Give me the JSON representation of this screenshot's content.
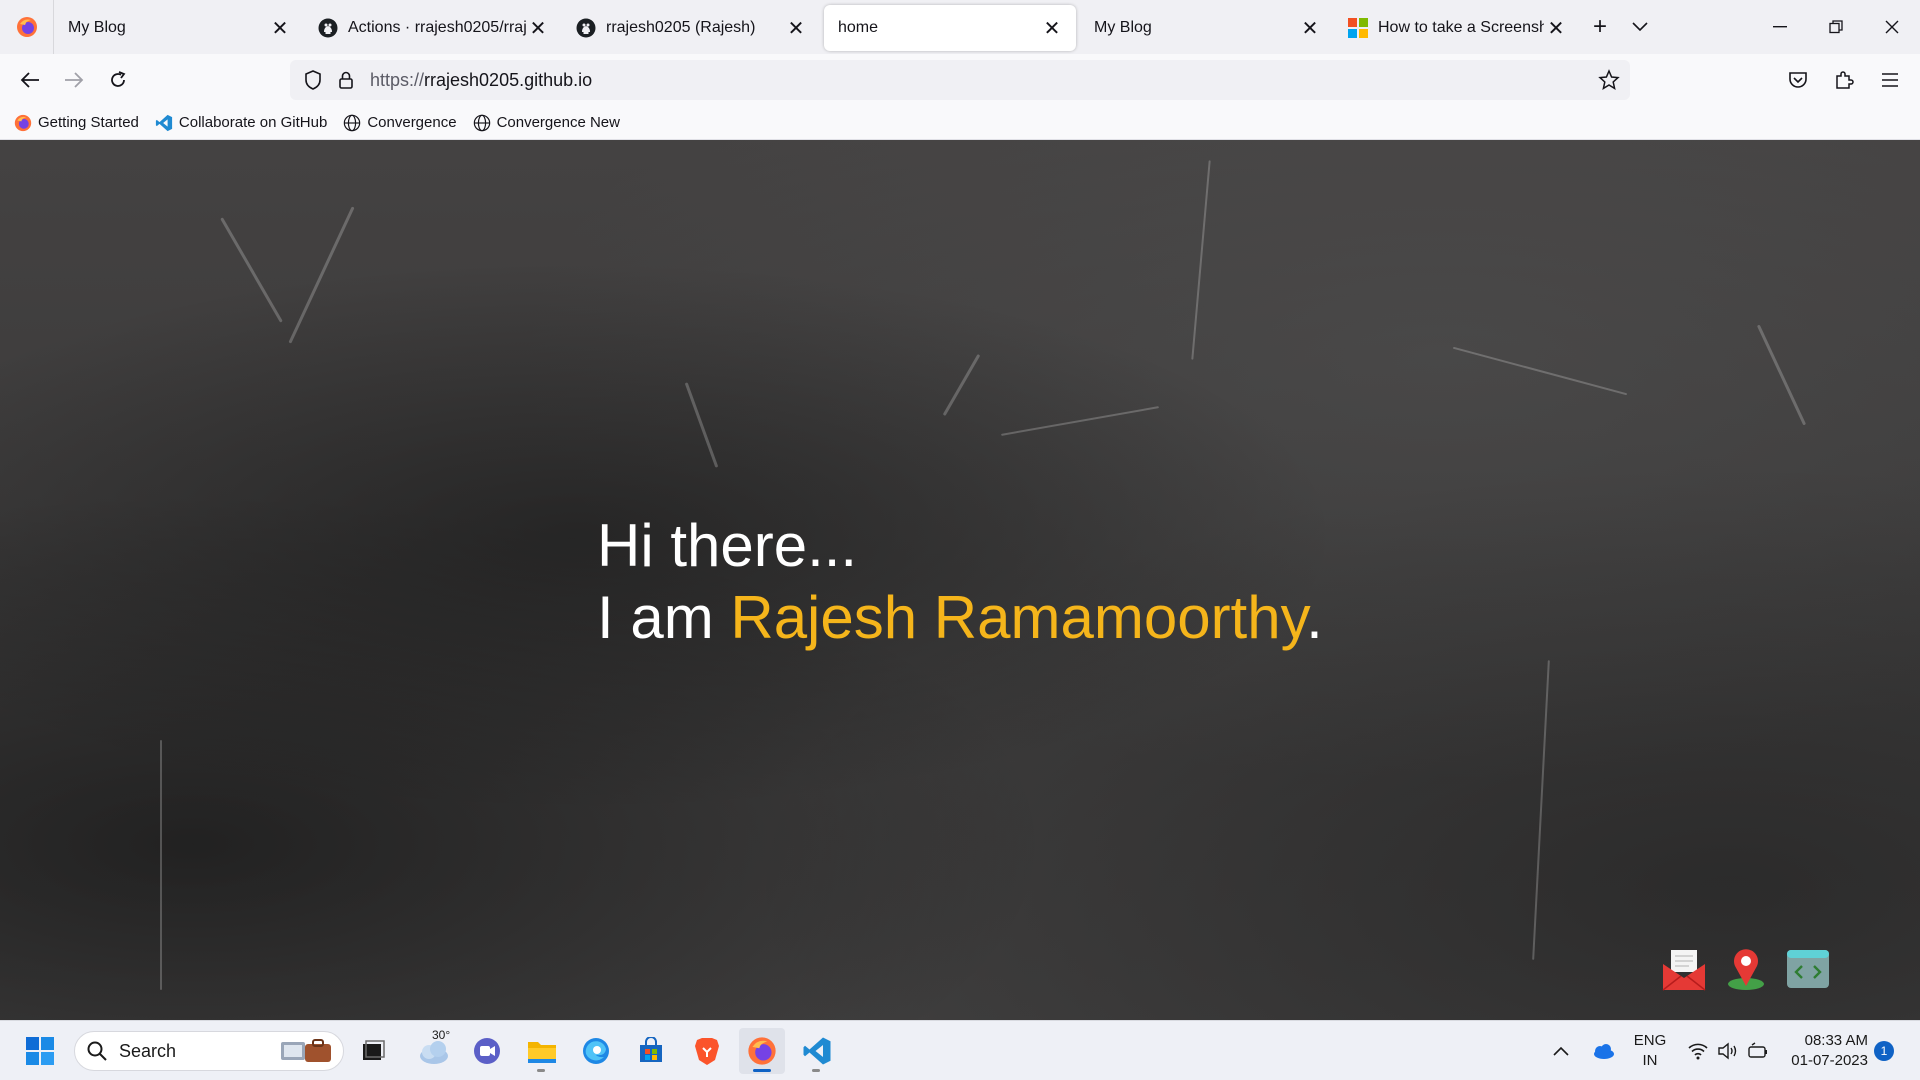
{
  "browser": {
    "tabs": [
      {
        "title": "My Blog",
        "icon": "firefox-blank-icon",
        "active": false
      },
      {
        "title": "Actions · rrajesh0205/rrajesh",
        "icon": "github-icon",
        "active": false
      },
      {
        "title": "rrajesh0205 (Rajesh)",
        "icon": "github-icon",
        "active": false
      },
      {
        "title": "home",
        "icon": "none",
        "active": true
      },
      {
        "title": "My Blog",
        "icon": "none",
        "active": false
      },
      {
        "title": "How to take a Screenshot in",
        "icon": "microsoft-icon",
        "active": false
      }
    ],
    "url_protocol": "https://",
    "url_host": "rrajesh0205.github.io",
    "bookmarks": [
      {
        "label": "Getting Started",
        "icon": "firefox-icon"
      },
      {
        "label": "Collaborate on GitHub",
        "icon": "vscode-icon"
      },
      {
        "label": "Convergence",
        "icon": "globe-icon"
      },
      {
        "label": "Convergence New",
        "icon": "globe-icon"
      }
    ]
  },
  "page": {
    "line1": "Hi there...",
    "line2_prefix": "I am ",
    "name": "Rajesh Ramamoorthy",
    "line2_suffix": ".",
    "name_color": "#f5b51b",
    "contact_icons": [
      "mail-icon",
      "location-pin-icon",
      "code-icon"
    ]
  },
  "taskbar": {
    "search_label": "Search",
    "weather_temp": "30°",
    "language_line1": "ENG",
    "language_line2": "IN",
    "time": "08:33 AM",
    "date": "01-07-2023",
    "notification_count": "1"
  }
}
